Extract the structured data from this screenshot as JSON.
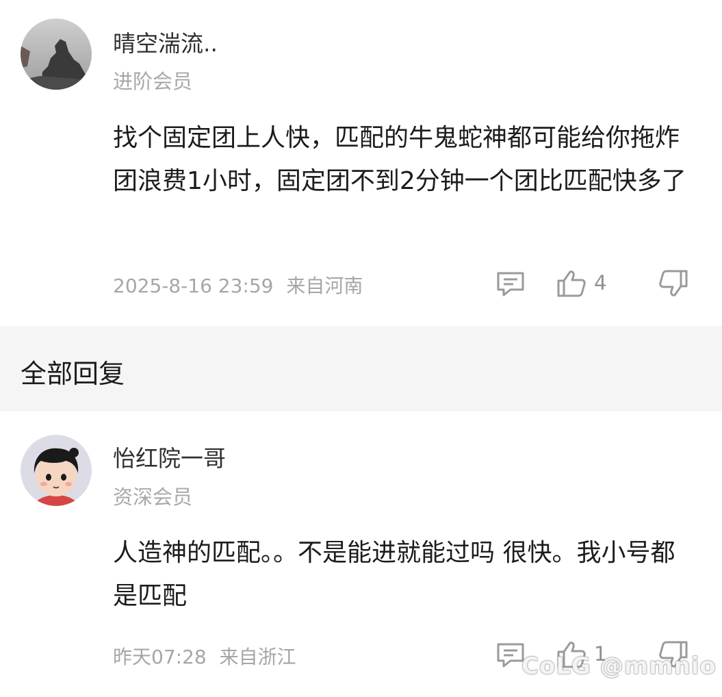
{
  "main_comment": {
    "username": "晴空湍流..",
    "member_level": "进阶会员",
    "text": "找个固定团上人快，匹配的牛鬼蛇神都可能给你拖炸团浪费1小时，固定团不到2分钟一个团比匹配快多了",
    "timestamp": "2025-8-16 23:59",
    "location": "来自河南",
    "like_count": "4",
    "icons": [
      "reply-icon",
      "thumbs-up-icon",
      "thumbs-down-icon"
    ]
  },
  "replies_section": {
    "title": "全部回复"
  },
  "replies": [
    {
      "username": "怡红院一哥",
      "member_level": "资深会员",
      "text": "人造神的匹配。。不是能进就能过吗 很快。我小号都是匹配",
      "timestamp": "昨天07:28",
      "location": "来自浙江",
      "like_count": "1"
    }
  ],
  "watermark": "CoLG @mmnio",
  "colors": {
    "section_background": "#f5f5f5",
    "meta_text": "#a6a6a6",
    "icon": "#9a9a9a"
  }
}
